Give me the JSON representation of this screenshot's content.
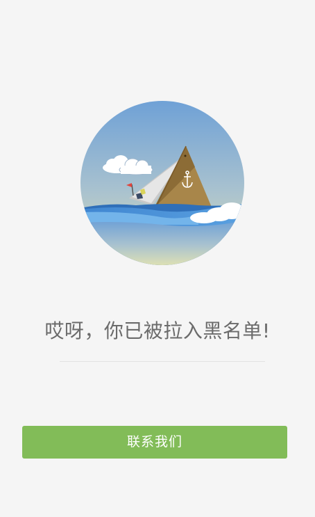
{
  "message": {
    "text": "哎呀，你已被拉入黑名单!"
  },
  "contact_button": {
    "label": "联系我们"
  },
  "colors": {
    "background": "#f5f5f5",
    "button": "#82bc58",
    "text": "#6b6b6b",
    "sky_top": "#6fa3d6",
    "sky_bottom": "#d9dfb4",
    "sea": "#4a90d6",
    "sail": "#a8864a"
  },
  "illustration": {
    "icon": "sinking-ship-illustration",
    "anchor_icon": "anchor-icon",
    "flag_icon": "flag-icon",
    "cloud_icon": "cloud-icon"
  }
}
